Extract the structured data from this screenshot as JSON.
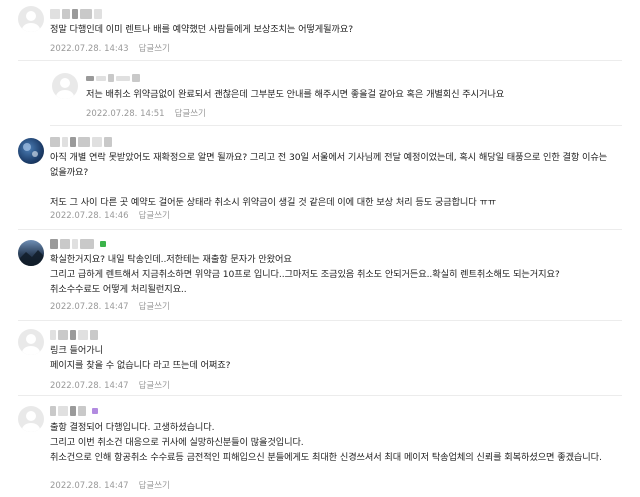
{
  "comments": [
    {
      "text": "정말 다행인데 이미 렌트나 배를 예약했던 사람들에게 보상조치는 어떻게될까요?",
      "date": "2022.07.28. 14:43",
      "reply_label": "답글쓰기"
    },
    {
      "text": "저는 배취소 위약금없이 완료되서 괜찮은데 그부분도 안내를 해주시면 좋을걸 같아요 혹은 개별회신 주시거나요",
      "date": "2022.07.28. 14:51",
      "reply_label": "답글쓰기"
    },
    {
      "text": "아직 개별 연락 못받았어도 재확정으로 알면 될까요? 그리고 전 30일 서울에서 기사님께 전달 예정이었는데, 혹시 해당일 태풍으로 인한 결항 이슈는 없을까요?\n\n저도 그 사이 다른 곳 예약도 걸어둔 상태라 취소시 위약금이 생길 것 같은데 이에 대한 보상 처리 등도 궁금합니다 ㅠㅠ",
      "date": "2022.07.28. 14:46",
      "reply_label": "답글쓰기"
    },
    {
      "text": "확실한거지요? 내일 탁송인데..저한테는 재출항 문자가 안왔어요\n그리고 급하게 렌트해서 지금취소하면 위약금 10프로 입니다..그마저도 조금있음 취소도 안되거든요..확실히 렌트취소해도 되는거지요?\n취소수수료도 어떻게 처리될런지요..",
      "date": "2022.07.28. 14:47",
      "reply_label": "답글쓰기"
    },
    {
      "text": "링크 들어가니\n페이지를 찾을 수 없습니다 라고 뜨는데 어쩌죠?",
      "date": "2022.07.28. 14:47",
      "reply_label": "답글쓰기"
    },
    {
      "text": "출항 결정되어 다행입니다. 고생하셨습니다.\n그리고 이번 취소건 대응으로 귀사에 실망하신분들이 많을것입니다.\n취소건으로 인해 항공취소 수수료등 금전적인 피해입으신 분들에게도 최대한 신경쓰셔서 최대 메이저 탁송업체의 신뢰를 회복하셨으면 좋겠습니다.",
      "date": "2022.07.28. 14:47",
      "reply_label": "답글쓰기"
    }
  ],
  "colors": {
    "badge_green": "#3bb34a",
    "badge_purple": "#b28be0"
  }
}
